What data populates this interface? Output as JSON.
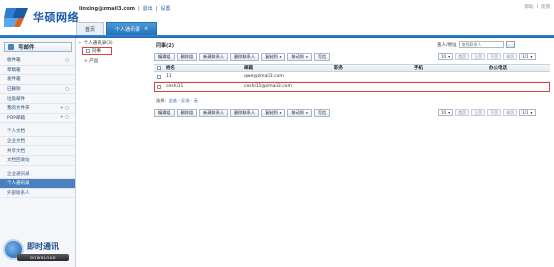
{
  "brand": {
    "name": "华硕网络"
  },
  "user": {
    "email": "linxing@zmail3.com",
    "logout": "退出",
    "settings": "设置"
  },
  "top_right": {
    "help": "帮助",
    "feedback": "反馈"
  },
  "tabs": [
    {
      "label": "首页"
    },
    {
      "label": "个人通讯录",
      "close": "×"
    }
  ],
  "sidebar": {
    "compose": "写邮件",
    "items": [
      {
        "label": "收件箱",
        "ctrl": "○"
      },
      {
        "label": "草稿箱"
      },
      {
        "label": "发件箱"
      },
      {
        "label": "已删除",
        "ctrl": "○"
      },
      {
        "label": "垃圾邮件"
      },
      {
        "label": "我的文件夹",
        "ctrl": "+ ○"
      },
      {
        "label": "POP邮箱",
        "ctrl": "+ ○"
      },
      {
        "label": "个人文档"
      },
      {
        "label": "企业文档"
      },
      {
        "label": "共享文档"
      },
      {
        "label": "文档回收站"
      },
      {
        "label": "企业通讯录"
      },
      {
        "label": "个人通讯录"
      },
      {
        "label": "外部联系人"
      }
    ]
  },
  "promo": {
    "title": "即时通讯",
    "download": "DOWNLOAD"
  },
  "tree": {
    "root": "个人通讯录(3)",
    "group": "同事",
    "item": "产品"
  },
  "main": {
    "title": "同事(2)",
    "search_label": "查人/地址",
    "search_placeholder": "查找联系人",
    "toolbar": [
      "编辑组",
      "删除组",
      "新建联系人",
      "删除联系人",
      "复制到",
      "移动到",
      "写信"
    ],
    "toolbar_dropdowns": {
      "copy": "▾",
      "move": "▾"
    },
    "pager": {
      "size": "10",
      "first": "首页",
      "prev": "上页",
      "next": "下页",
      "last": "末页",
      "page": "1/1"
    },
    "columns": {
      "name": "姓名",
      "email": "邮箱",
      "title": "职务",
      "phone": "手机",
      "office": "办公电话"
    },
    "rows": [
      {
        "name": "11",
        "email": "qwe@zmail3.com",
        "title": "",
        "phone": "",
        "office": ""
      },
      {
        "name": "ceshi11",
        "email": "ceshi11@zmail3.com",
        "title": "",
        "phone": "",
        "office": ""
      }
    ],
    "select": {
      "label": "选择：",
      "all": "全选",
      "sep1": " - ",
      "invert": "反选",
      "sep2": " - ",
      "none": "无"
    }
  }
}
